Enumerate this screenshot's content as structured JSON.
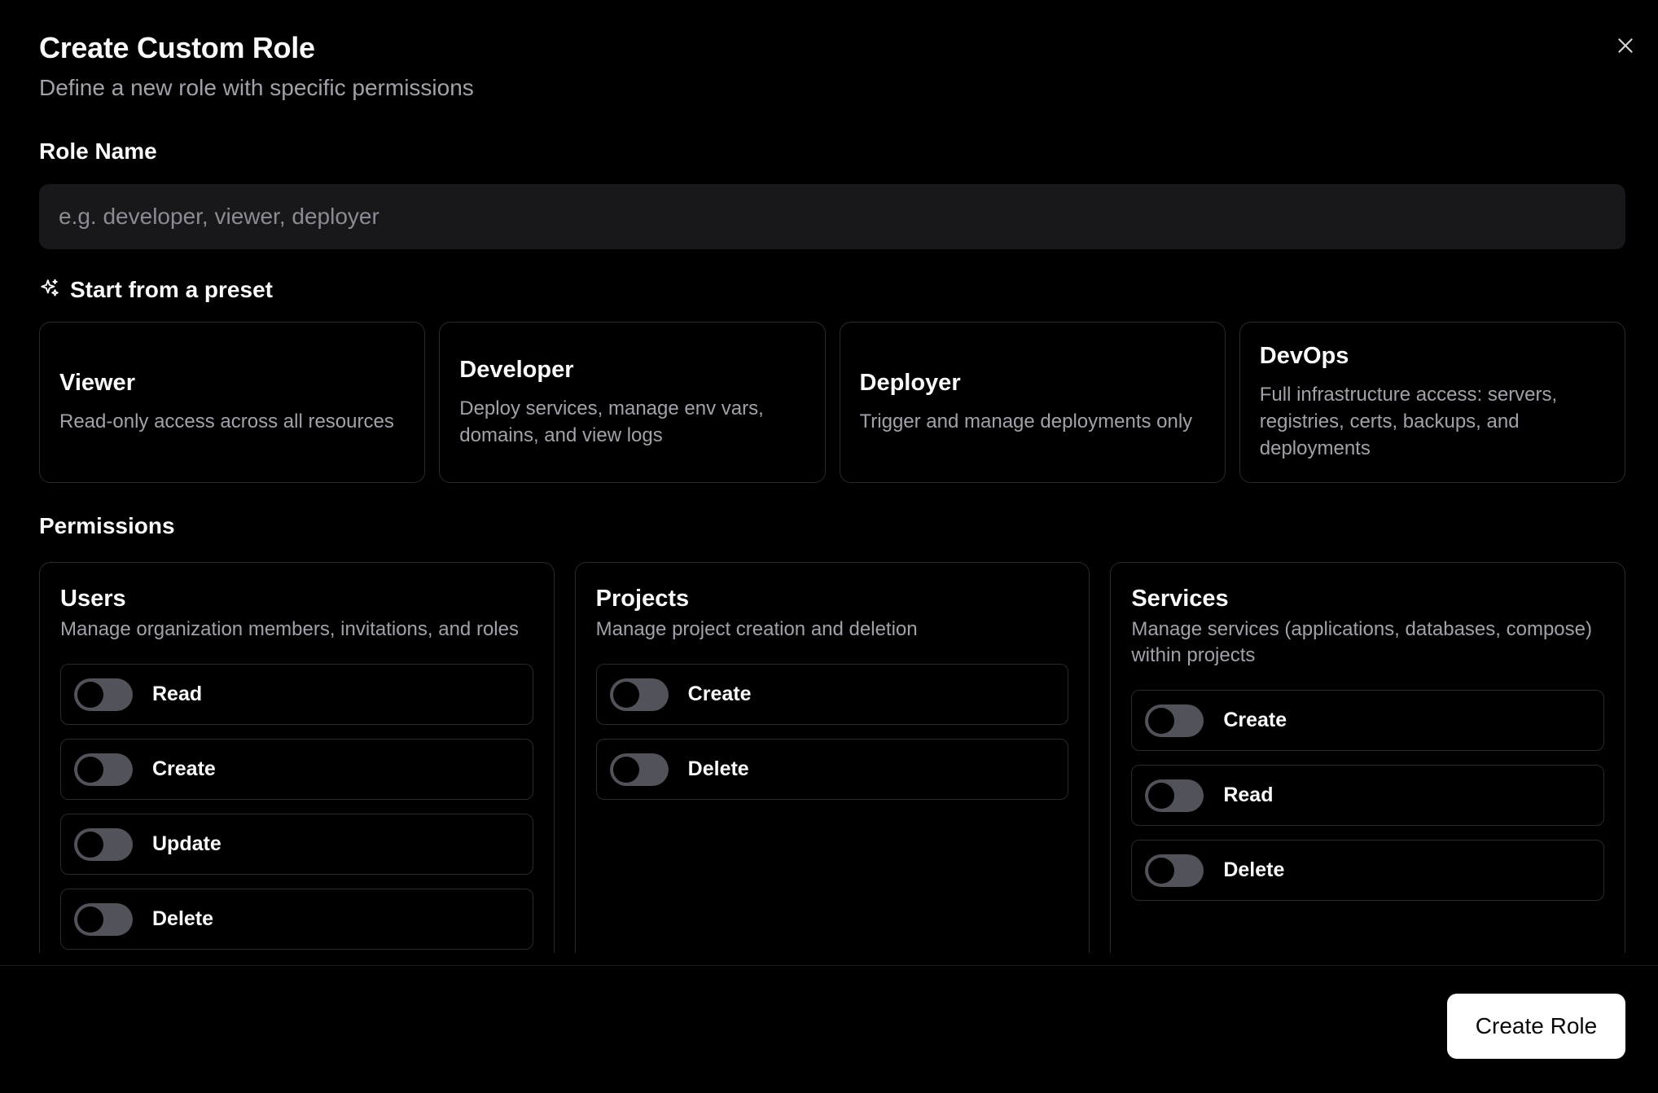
{
  "dialog": {
    "title": "Create Custom Role",
    "subtitle": "Define a new role with specific permissions",
    "close_icon": "close-icon"
  },
  "role_name": {
    "label": "Role Name",
    "value": "",
    "placeholder": "e.g. developer, viewer, deployer"
  },
  "presets": {
    "heading": "Start from a preset",
    "icon": "sparkles-icon",
    "items": [
      {
        "name": "Viewer",
        "description": "Read-only access across all resources"
      },
      {
        "name": "Developer",
        "description": "Deploy services, manage env vars, domains, and view logs"
      },
      {
        "name": "Deployer",
        "description": "Trigger and manage deployments only"
      },
      {
        "name": "DevOps",
        "description": "Full infrastructure access: servers, registries, certs, backups, and deployments"
      }
    ]
  },
  "permissions": {
    "heading": "Permissions",
    "groups": [
      {
        "title": "Users",
        "description": "Manage organization members, invitations, and roles",
        "actions": [
          {
            "label": "Read",
            "enabled": false
          },
          {
            "label": "Create",
            "enabled": false
          },
          {
            "label": "Update",
            "enabled": false
          },
          {
            "label": "Delete",
            "enabled": false
          }
        ]
      },
      {
        "title": "Projects",
        "description": "Manage project creation and deletion",
        "actions": [
          {
            "label": "Create",
            "enabled": false
          },
          {
            "label": "Delete",
            "enabled": false
          }
        ]
      },
      {
        "title": "Services",
        "description": "Manage services (applications, databases, compose) within projects",
        "actions": [
          {
            "label": "Create",
            "enabled": false
          },
          {
            "label": "Read",
            "enabled": false
          },
          {
            "label": "Delete",
            "enabled": false
          }
        ]
      }
    ]
  },
  "footer": {
    "submit_label": "Create Role"
  },
  "colors": {
    "background": "#000000",
    "surface": "#18181b",
    "border": "#2a2a2e",
    "muted_text": "#a1a1aa",
    "toggle_off": "#52525b",
    "primary_button": "#ffffff"
  }
}
